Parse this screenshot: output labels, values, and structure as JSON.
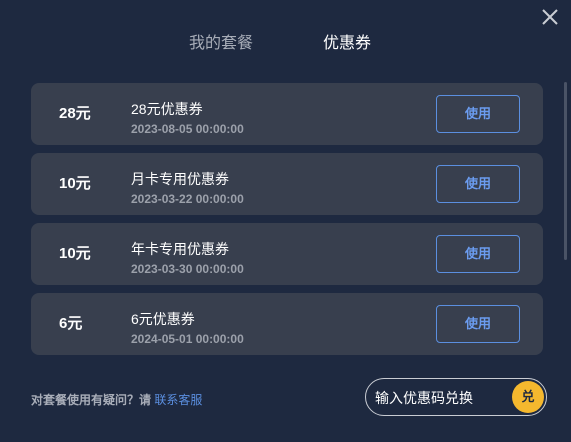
{
  "tabs": [
    {
      "label": "我的套餐"
    },
    {
      "label": "优惠券"
    }
  ],
  "coupons": [
    {
      "amount": "28元",
      "name": "28元优惠券",
      "date": "2023-08-05 00:00:00",
      "action": "使用"
    },
    {
      "amount": "10元",
      "name": "月卡专用优惠券",
      "date": "2023-03-22 00:00:00",
      "action": "使用"
    },
    {
      "amount": "10元",
      "name": "年卡专用优惠券",
      "date": "2023-03-30 00:00:00",
      "action": "使用"
    },
    {
      "amount": "6元",
      "name": "6元优惠券",
      "date": "2024-05-01 00:00:00",
      "action": "使用"
    }
  ],
  "footer": {
    "question": "对套餐使用有疑问？请",
    "contact_link": "联系客服"
  },
  "redeem": {
    "placeholder": "输入优惠码兑换",
    "button_label": "兑"
  },
  "colors": {
    "background": "#1e2940",
    "card": "#383f4e",
    "accent_blue": "#5b8fe0",
    "accent_yellow": "#f5b82e"
  },
  "icons": {
    "close": "close-icon"
  }
}
